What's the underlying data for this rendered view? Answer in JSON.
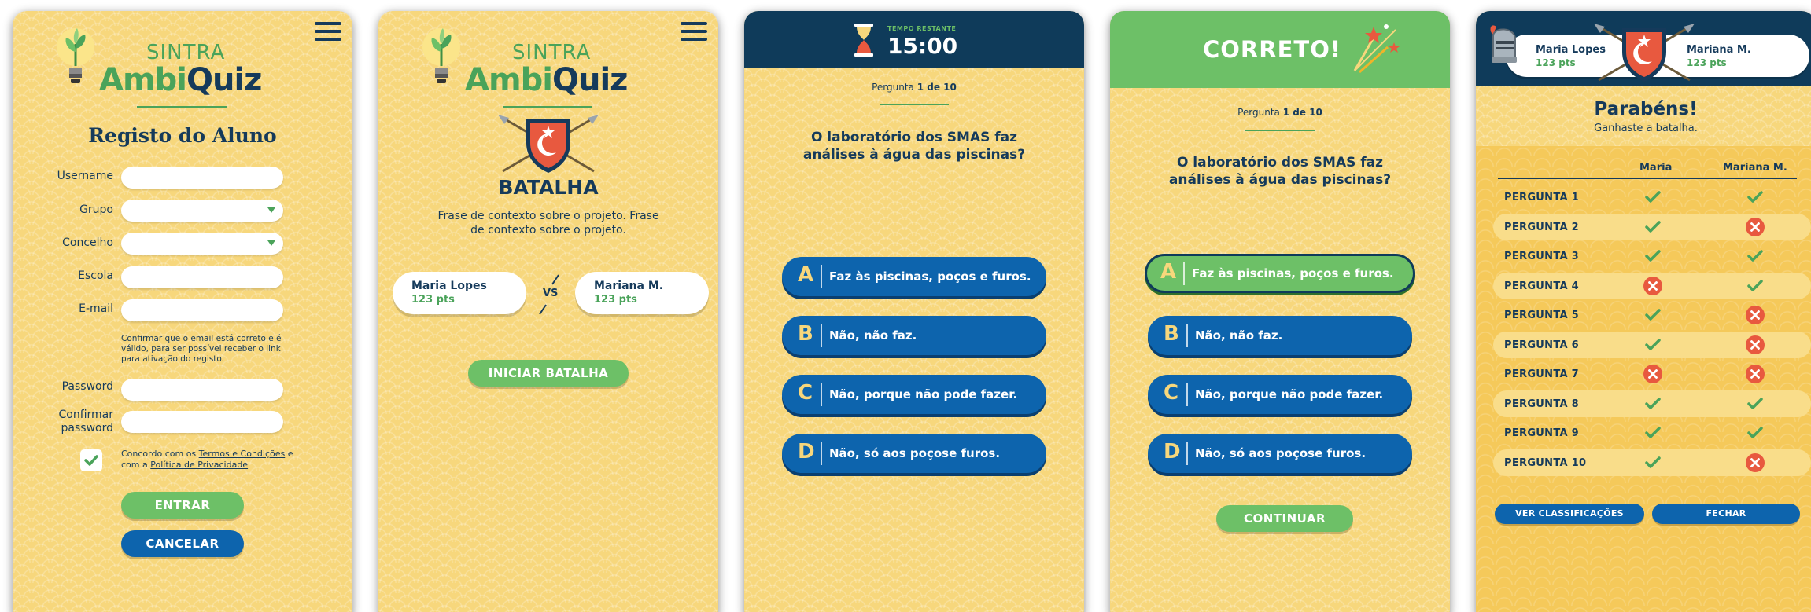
{
  "logo": {
    "top": "SINTRA",
    "main_green": "Ambi",
    "main_blue": "Quiz"
  },
  "register": {
    "title": "Registo do Aluno",
    "labels": {
      "username": "Username",
      "grupo": "Grupo",
      "concelho": "Concelho",
      "escola": "Escola",
      "email": "E-mail",
      "password": "Password",
      "confirm_l1": "Confirmar",
      "confirm_l2": "password"
    },
    "values": {
      "username": "",
      "grupo": "",
      "concelho": "",
      "escola": "",
      "email": "",
      "password": "",
      "confirm": ""
    },
    "email_hint": "Confirmar que o email está correto e é válido, para ser possível receber o link para ativação do registo.",
    "terms_prefix": "Concordo com os ",
    "terms_link": "Termos e Condições",
    "terms_mid": " e com a ",
    "privacy_link": "Política de Privacidade",
    "terms_checked": true,
    "enter_button": "ENTRAR",
    "cancel_button": "CANCELAR"
  },
  "battle": {
    "title": "BATALHA",
    "context": "Frase de contexto sobre o projeto. Frase de contexto sobre o projeto.",
    "player1": {
      "name": "Maria Lopes",
      "points": "123 pts"
    },
    "player2": {
      "name": "Mariana M.",
      "points": "123 pts"
    },
    "vs": "VS",
    "start_button": "INICIAR BATALHA"
  },
  "quiz": {
    "timer_label": "TEMPO RESTANTE",
    "timer_value": "15:00",
    "progress_prefix": "Pergunta ",
    "progress_value": "1 de 10",
    "question": "O laboratório dos SMAS faz análises à água das piscinas?",
    "answers": [
      {
        "letter": "A",
        "text": "Faz às piscinas, poços e furos."
      },
      {
        "letter": "B",
        "text": "Não, não faz."
      },
      {
        "letter": "C",
        "text": "Não, porque não pode fazer."
      },
      {
        "letter": "D",
        "text": "Não, só aos poçose furos."
      }
    ]
  },
  "feedback": {
    "title": "CORRETO!",
    "continue_button": "CONTINUAR",
    "correct_answer_index": 0
  },
  "results": {
    "player1": {
      "name": "Maria Lopes",
      "points": "123 pts",
      "short": "Maria"
    },
    "player2": {
      "name": "Mariana M.",
      "points": "123 pts",
      "short": "Mariana M."
    },
    "title": "Parabéns!",
    "subtitle": "Ganhaste a batalha.",
    "rows": [
      {
        "label": "PERGUNTA 1",
        "p1": true,
        "p2": true
      },
      {
        "label": "PERGUNTA 2",
        "p1": true,
        "p2": false
      },
      {
        "label": "PERGUNTA 3",
        "p1": true,
        "p2": true
      },
      {
        "label": "PERGUNTA 4",
        "p1": false,
        "p2": true
      },
      {
        "label": "PERGUNTA 5",
        "p1": true,
        "p2": false
      },
      {
        "label": "PERGUNTA 6",
        "p1": true,
        "p2": false
      },
      {
        "label": "PERGUNTA 7",
        "p1": false,
        "p2": false
      },
      {
        "label": "PERGUNTA 8",
        "p1": true,
        "p2": true
      },
      {
        "label": "PERGUNTA 9",
        "p1": true,
        "p2": true
      },
      {
        "label": "PERGUNTA 10",
        "p1": true,
        "p2": false
      }
    ],
    "rank_button": "VER CLASSIFICAÇÕES",
    "close_button": "FECHAR"
  },
  "colors": {
    "background": "#f7d77c",
    "navy": "#0f3b5a",
    "blue": "#0d64ad",
    "green": "#6dc067",
    "red": "#e8593f"
  }
}
